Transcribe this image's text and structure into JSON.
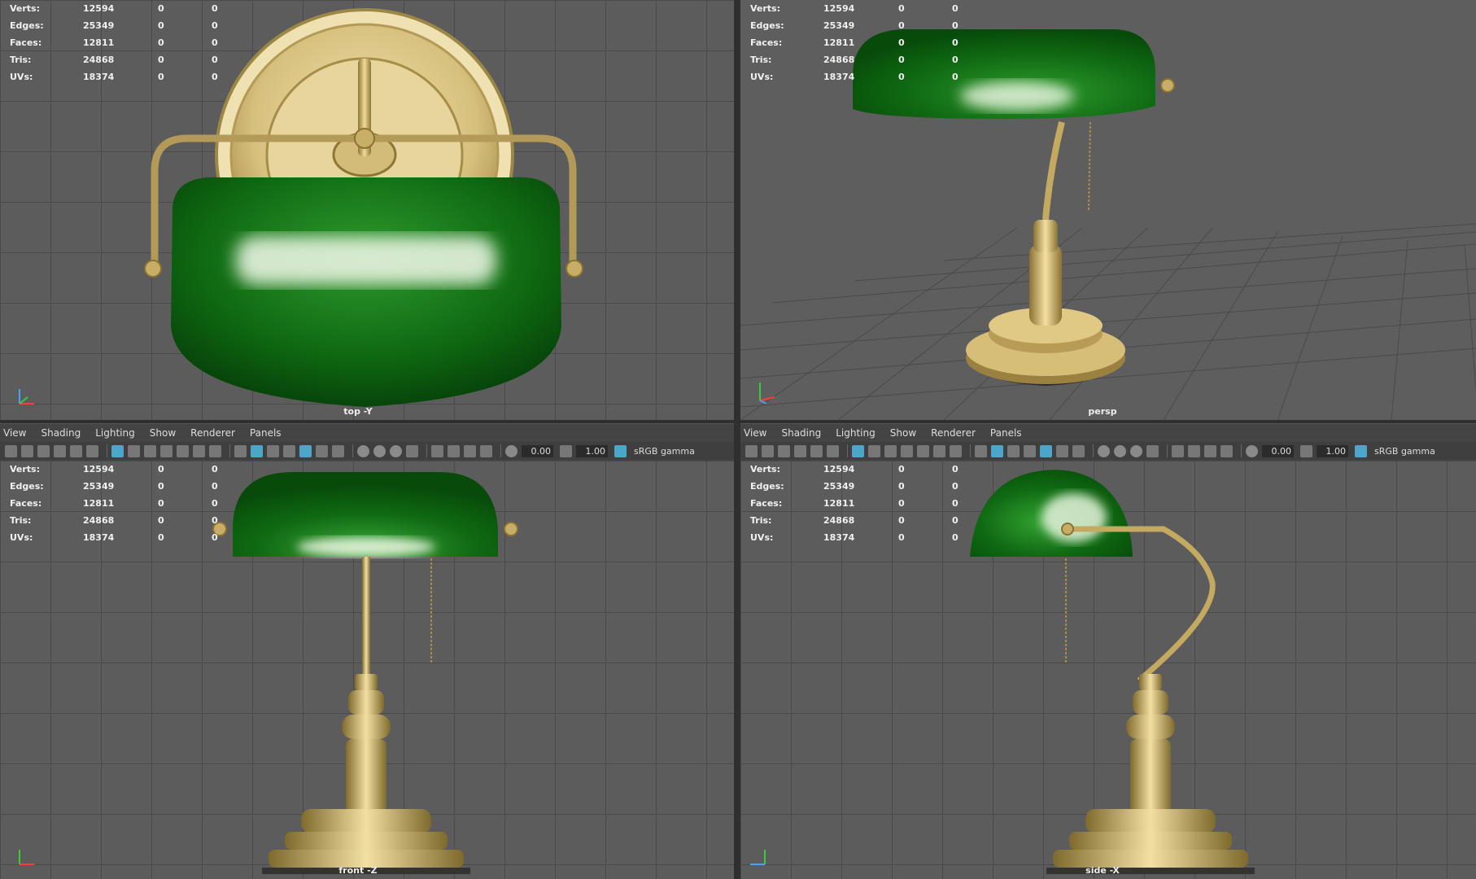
{
  "hud": [
    {
      "label": "Verts:",
      "v1": "12594",
      "v2": "0",
      "v3": "0"
    },
    {
      "label": "Edges:",
      "v1": "25349",
      "v2": "0",
      "v3": "0"
    },
    {
      "label": "Faces:",
      "v1": "12811",
      "v2": "0",
      "v3": "0"
    },
    {
      "label": "Tris:",
      "v1": "24868",
      "v2": "0",
      "v3": "0"
    },
    {
      "label": "UVs:",
      "v1": "18374",
      "v2": "0",
      "v3": "0"
    }
  ],
  "viewports": {
    "top": {
      "camera": "top -Y"
    },
    "persp": {
      "camera": "persp"
    },
    "front": {
      "camera": "front -Z"
    },
    "side": {
      "camera": "side -X"
    }
  },
  "menu": [
    "View",
    "Shading",
    "Lighting",
    "Show",
    "Renderer",
    "Panels"
  ],
  "toolbar": {
    "exposure": "0.00",
    "gamma": "1.00",
    "color_space": "sRGB gamma"
  },
  "colors": {
    "shade_green": "#0f6a12",
    "brass": "#c8b06a",
    "viewport_bg": "#5c5c5c",
    "active_icon": "#4aa7c9"
  }
}
